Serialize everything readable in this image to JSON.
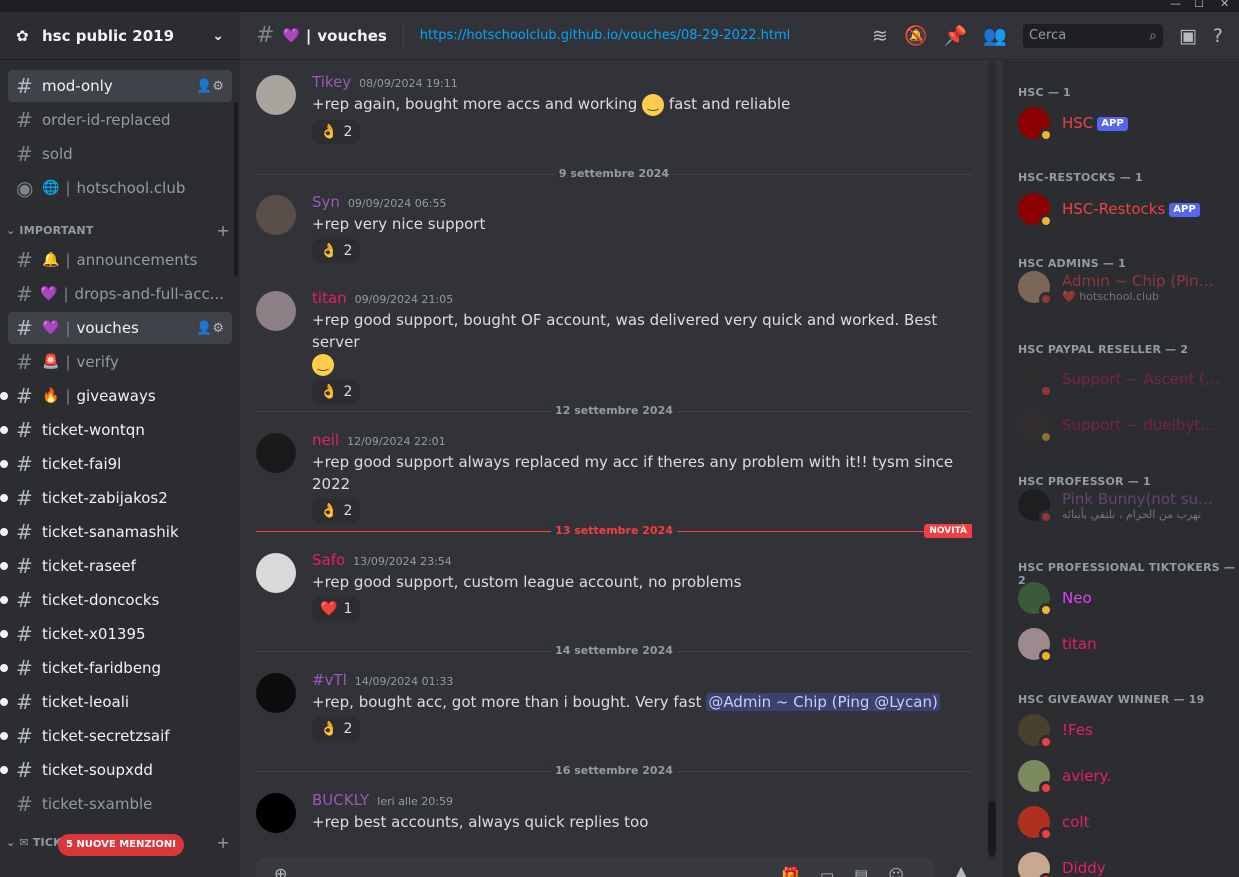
{
  "window": {
    "controls": [
      "—",
      "☐",
      "✕"
    ]
  },
  "server": {
    "name": "hsc public 2019"
  },
  "sidebar": {
    "top_channels": [
      {
        "name": "mod-only",
        "active": true
      },
      {
        "name": "order-id-replaced"
      },
      {
        "name": "sold"
      },
      {
        "name": "hotschool.club",
        "emoji": "🌐",
        "type": "stage"
      }
    ],
    "important_category": "IMPORTANT",
    "important_channels": [
      {
        "name": "announcements",
        "emoji": "🔔"
      },
      {
        "name": "drops-and-full-acc...",
        "emoji": "💜"
      },
      {
        "name": "vouches",
        "emoji": "💜",
        "active": true
      },
      {
        "name": "verify",
        "emoji": "🚨"
      },
      {
        "name": "giveaways",
        "emoji": "🔥",
        "unread": true
      }
    ],
    "ticket_channels": [
      "ticket-wontqn",
      "ticket-fai9l",
      "ticket-zabijakos2",
      "ticket-sanamashik",
      "ticket-raseef",
      "ticket-doncocks",
      "ticket-x01395",
      "ticket-faridbeng",
      "ticket-leoali",
      "ticket-secretzsaif",
      "ticket-soupxdd"
    ],
    "read_ticket": "ticket-sxamble",
    "tickets_category": "TICKETS",
    "mentions_pill": "5 NUOVE MENZIONI"
  },
  "header": {
    "channel_emoji": "💜",
    "channel_name": "vouches",
    "topic": "https://hotschoolclub.github.io/vouches/08-29-2022.html",
    "search_placeholder": "Cerca"
  },
  "messages": [
    {
      "user": "Tikey",
      "color": "#9b59b6",
      "time": "08/09/2024 19:11",
      "text": "+rep again, bought more accs and working",
      "text2": "fast and reliable",
      "emoji_inline": true,
      "reaction": "👌",
      "count": "2"
    },
    {
      "user": "Syn",
      "color": "#9b59b6",
      "time": "09/09/2024 06:55",
      "text": "+rep very nice support",
      "reaction": "👌",
      "count": "2"
    },
    {
      "user": "titan",
      "color": "#e91e63",
      "time": "09/09/2024 21:05",
      "text": "+rep good support, bought OF account, was delivered very quick and worked. Best server",
      "reaction": "👌",
      "count": "2"
    },
    {
      "user": "neil",
      "color": "#e91e63",
      "time": "12/09/2024 22:01",
      "text": "+rep good support always replaced my acc if theres any problem with it!! tysm since 2022",
      "reaction": "👌",
      "count": "2"
    },
    {
      "user": "Safo",
      "color": "#e91e63",
      "time": "13/09/2024 23:54",
      "text": "+rep good support, custom league account, no problems",
      "reaction": "❤️",
      "count": "1"
    },
    {
      "user": "#vTl",
      "color": "#9b59b6",
      "time": "14/09/2024 01:33",
      "text": "+rep, bought acc, got more than i  bought. Very fast",
      "mention": "@Admin ~ Chip (Ping @Lycan)",
      "reaction": "👌",
      "count": "2"
    },
    {
      "user": "BUCKLY",
      "color": "#9b59b6",
      "time": "Ieri alle 20:59",
      "text": "+rep best accounts, always quick replies too"
    }
  ],
  "day_separators": [
    "9 settembre 2024",
    "12 settembre 2024",
    "13 settembre 2024",
    "14 settembre 2024",
    "16 settembre 2024"
  ],
  "new_label": "NOVITÀ",
  "members": {
    "groups": [
      {
        "title": "HSC — 1"
      },
      {
        "title": "HSC-RESTOCKS — 1"
      },
      {
        "title": "HSC ADMINS — 1"
      },
      {
        "title": "HSC PAYPAL RESELLER — 2"
      },
      {
        "title": "HSC PROFESSOR — 1"
      },
      {
        "title": "HSC PROFESSIONAL TIKTOKERS — 2"
      },
      {
        "title": "HSC GIVEAWAY WINNER — 19"
      }
    ],
    "list": [
      {
        "name": "HSC",
        "color": "#ed4245",
        "badge": "APP",
        "status": "#f0b232"
      },
      {
        "name": "HSC-Restocks",
        "color": "#ed4245",
        "badge": "APP",
        "status": "#f0b232"
      },
      {
        "name": "Admin ~ Chip (Ping @...",
        "color": "#ed4245",
        "sub": "hotschool.club",
        "sub_emoji": "❤️",
        "status": "#f23f43",
        "dim": true
      },
      {
        "name": "Support ~ Ascent (Pa...",
        "color": "#c2185b",
        "status": "#f23f43",
        "dim": true
      },
      {
        "name": "Support ~ duelbytes (...",
        "color": "#c2185b",
        "status": "#f0b232",
        "dim": true
      },
      {
        "name": "Pink Bunny(not suppo...",
        "color": "#9b59b6",
        "sub": "نهرب من الحرام ، نلتقي بأبنائه",
        "status": "#f23f43",
        "dim": true
      },
      {
        "name": "Neo",
        "color": "#e040fb",
        "status": "#f0b232"
      },
      {
        "name": "titan",
        "color": "#e91e63",
        "status": "#f0b232"
      },
      {
        "name": "!Fes",
        "color": "#e91e63",
        "status": "#f23f43"
      },
      {
        "name": "aviery.",
        "color": "#e91e63",
        "status": "#f23f43"
      },
      {
        "name": "colt",
        "color": "#e91e63",
        "status": "#f23f43"
      },
      {
        "name": "Diddy",
        "color": "#e91e63",
        "status": "#f23f43"
      }
    ]
  }
}
